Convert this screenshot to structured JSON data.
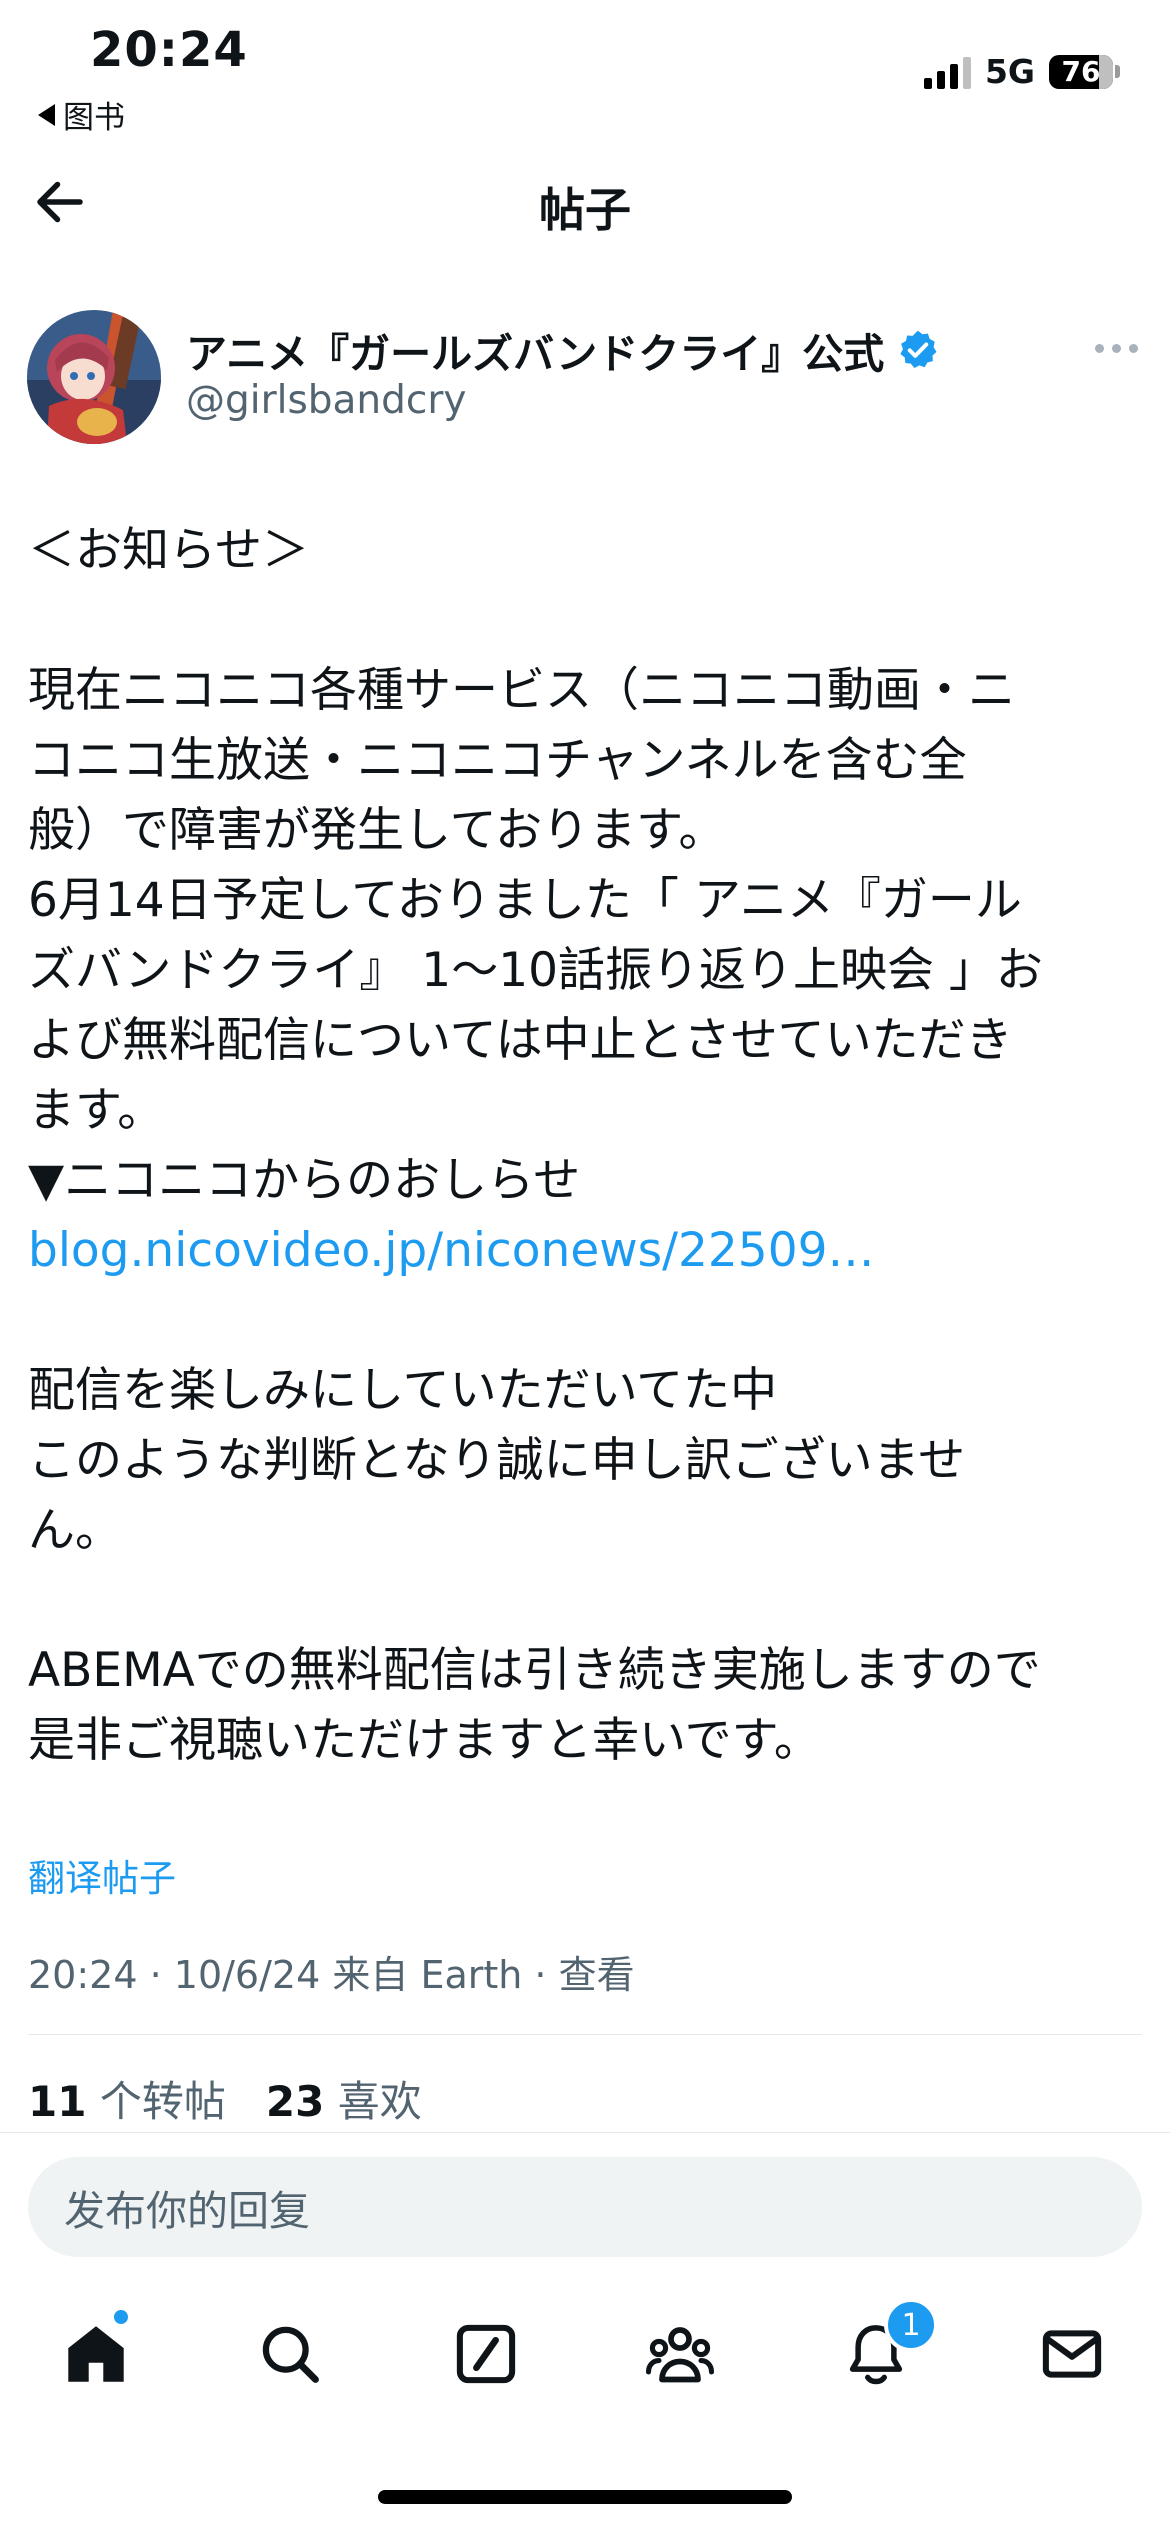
{
  "status_bar": {
    "time": "20:24",
    "back_app": "图书",
    "network": "5G",
    "battery": "76"
  },
  "header": {
    "title": "帖子"
  },
  "author": {
    "name": "アニメ『ガールズバンドクライ』公式",
    "handle": "@girlsbandcry",
    "verified": true
  },
  "post": {
    "lines": [
      "＜お知らせ＞",
      "",
      "現在ニコニコ各種サービス（ニコニコ動画・ニ",
      "コニコ生放送・ニコニコチャンネルを含む全",
      "般）で障害が発生しております。",
      "6月14日予定しておりました「 アニメ『ガール",
      "ズバンドクライ』 1〜10話振り返り上映会 」お",
      "よび無料配信については中止とさせていただき",
      "ます。",
      "▼ニコニコからのおしらせ"
    ],
    "link": "blog.nicovideo.jp/niconews/22509…",
    "lines_after": [
      "",
      "配信を楽しみにしていただいてた中",
      "このような判断となり誠に申し訳ございませ",
      "ん。",
      "",
      "ABEMAでの無料配信は引き続き実施しますので",
      "是非ご視聴いただけますと幸いです。"
    ]
  },
  "translate_label": "翻译帖子",
  "meta": {
    "time": "20:24",
    "date": "10/6/24",
    "source": "来自 Earth",
    "view": "查看"
  },
  "stats": {
    "reposts_count": "11",
    "reposts_label": "个转帖",
    "likes_count": "23",
    "likes_label": "喜欢"
  },
  "reply": {
    "placeholder": "发布你的回复"
  },
  "tabs": {
    "items": [
      "home-icon",
      "search-icon",
      "grok-icon",
      "communities-icon",
      "notifications-icon",
      "messages-icon"
    ],
    "notification_badge": "1"
  },
  "colors": {
    "accent": "#1d9bf0",
    "secondary_text": "#536471",
    "text": "#0f1419"
  }
}
